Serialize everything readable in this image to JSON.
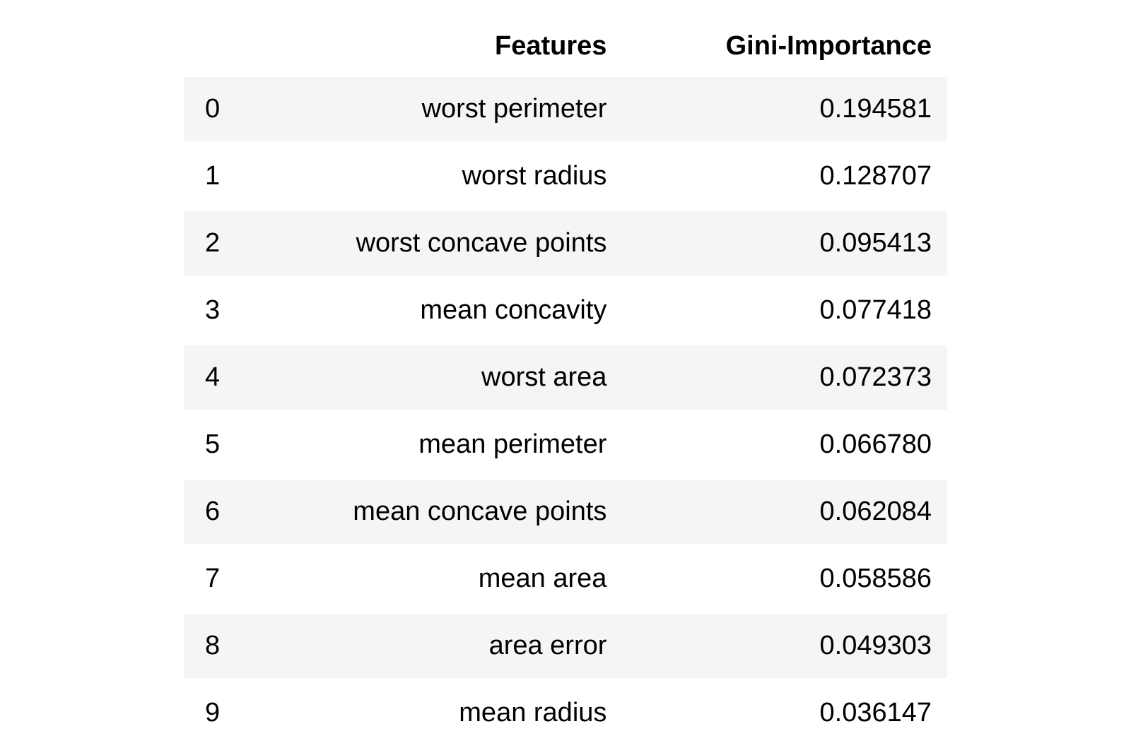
{
  "table": {
    "columns": {
      "index": "",
      "features": "Features",
      "gini": "Gini-Importance"
    },
    "rows": [
      {
        "index": "0",
        "feature": "worst perimeter",
        "gini": "0.194581"
      },
      {
        "index": "1",
        "feature": "worst radius",
        "gini": "0.128707"
      },
      {
        "index": "2",
        "feature": "worst concave points",
        "gini": "0.095413"
      },
      {
        "index": "3",
        "feature": "mean concavity",
        "gini": "0.077418"
      },
      {
        "index": "4",
        "feature": "worst area",
        "gini": "0.072373"
      },
      {
        "index": "5",
        "feature": "mean perimeter",
        "gini": "0.066780"
      },
      {
        "index": "6",
        "feature": "mean concave points",
        "gini": "0.062084"
      },
      {
        "index": "7",
        "feature": "mean area",
        "gini": "0.058586"
      },
      {
        "index": "8",
        "feature": "area error",
        "gini": "0.049303"
      },
      {
        "index": "9",
        "feature": "mean radius",
        "gini": "0.036147"
      }
    ]
  }
}
